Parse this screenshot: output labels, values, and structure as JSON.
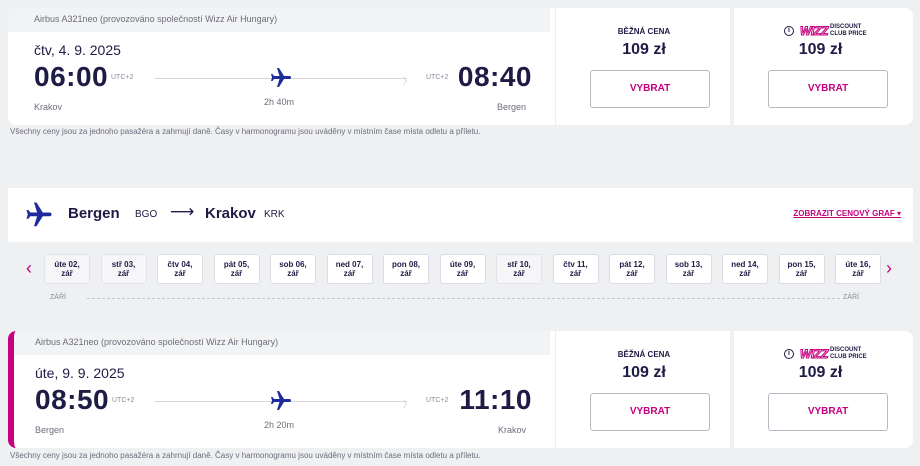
{
  "flights": [
    {
      "aircraft": "Airbus A321neo (provozováno společností Wizz Air Hungary)",
      "date": "čtv, 4. 9. 2025",
      "dep_time": "06:00",
      "arr_time": "08:40",
      "dep_tz": "UTC+2",
      "arr_tz": "UTC+2",
      "duration": "2h 40m",
      "dep_city": "Krakov",
      "arr_city": "Bergen",
      "regular_label": "BĚŽNÁ CENA",
      "regular_price": "109 zł",
      "club_price": "109 zł",
      "select_label": "VYBRAT"
    },
    {
      "aircraft": "Airbus A321neo (provozováno společností Wizz Air Hungary)",
      "date": "úte, 9. 9. 2025",
      "dep_time": "08:50",
      "arr_time": "11:10",
      "dep_tz": "UTC+2",
      "arr_tz": "UTC+2",
      "duration": "2h 20m",
      "dep_city": "Bergen",
      "arr_city": "Krakov",
      "regular_label": "BĚŽNÁ CENA",
      "regular_price": "109 zł",
      "club_price": "109 zł",
      "select_label": "VYBRAT"
    }
  ],
  "club_logo": {
    "brand": "WIZZ",
    "line1": "DISCOUNT",
    "line2": "CLUB PRICE"
  },
  "disclaimer": "Všechny ceny jsou za jednoho pasažéra a zahrnují daně. Časy v harmonogramu jsou uváděny v místním čase místa odletu a příletu.",
  "route": {
    "from": "Bergen",
    "from_code": "BGO",
    "arrow": "⟶",
    "to": "Krakov",
    "to_code": "KRK",
    "price_graph": "ZOBRAZIT CENOVÝ GRAF ▾"
  },
  "calendar": {
    "prev": "‹",
    "next": "›",
    "days": [
      {
        "d": "úte 02,",
        "m": "zář",
        "dim": true
      },
      {
        "d": "stř 03,",
        "m": "zář",
        "dim": true
      },
      {
        "d": "čtv 04,",
        "m": "zář",
        "dim": false
      },
      {
        "d": "pát 05,",
        "m": "zář",
        "dim": false
      },
      {
        "d": "sob 06,",
        "m": "zář",
        "dim": false
      },
      {
        "d": "ned 07,",
        "m": "zář",
        "dim": false
      },
      {
        "d": "pon 08,",
        "m": "zář",
        "dim": false
      },
      {
        "d": "úte 09,",
        "m": "zář",
        "dim": false
      },
      {
        "d": "stř 10,",
        "m": "zář",
        "dim": true
      },
      {
        "d": "čtv 11,",
        "m": "zář",
        "dim": false
      },
      {
        "d": "pát 12,",
        "m": "zář",
        "dim": false
      },
      {
        "d": "sob 13,",
        "m": "zář",
        "dim": false
      },
      {
        "d": "ned 14,",
        "m": "zář",
        "dim": false
      },
      {
        "d": "pon 15,",
        "m": "zář",
        "dim": false
      },
      {
        "d": "úte 16,",
        "m": "zář",
        "dim": false
      }
    ],
    "month_left": "ZÁŘÍ",
    "month_right": "ZÁŘÍ"
  },
  "colors": {
    "accent": "#c6007e",
    "navy": "#1e1b45",
    "plane": "#1f2a9e"
  }
}
